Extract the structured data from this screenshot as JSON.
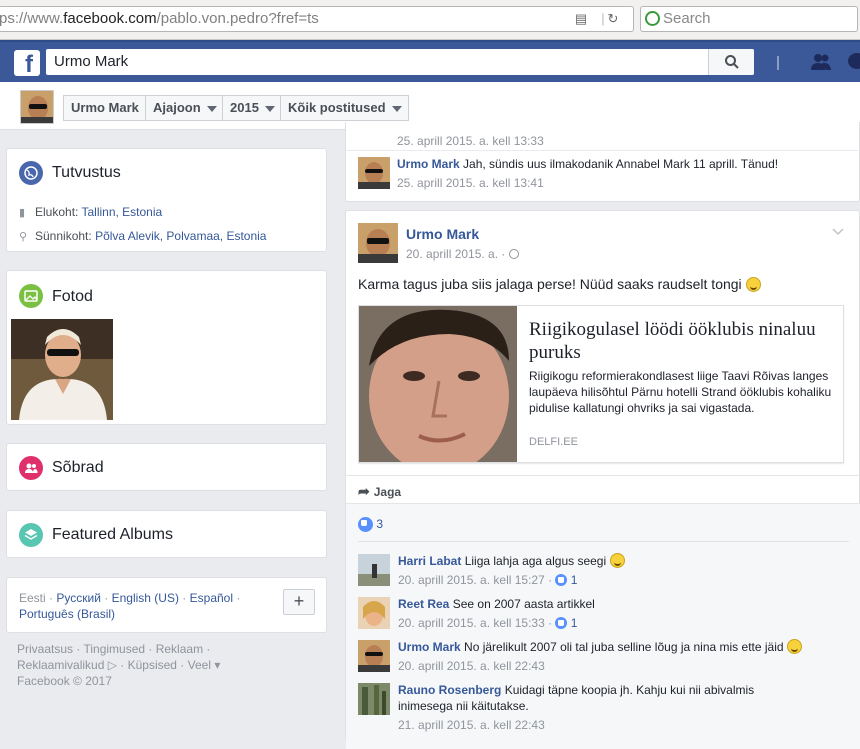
{
  "browser": {
    "url_prefix": "ps://www.",
    "url_domain": "facebook.com",
    "url_path": "/pablo.von.pedro?fref=ts",
    "search_placeholder": "Search"
  },
  "fb": {
    "logo": "f",
    "search_value": "Urmo Mark"
  },
  "timeline_nav": {
    "name": "Urmo Mark",
    "tab": "Ajajoon",
    "year": "2015",
    "filter": "Kõik postitused"
  },
  "intro": {
    "title": "Tutvustus",
    "residence_label": "Elukoht:",
    "residence_value": "Tallinn, Estonia",
    "birthplace_label": "Sünnikoht:",
    "birthplace_value": "Põlva Alevik, Polvamaa, Estonia"
  },
  "photos": {
    "title": "Fotod"
  },
  "friends": {
    "title": "Sõbrad"
  },
  "albums": {
    "title": "Featured Albums"
  },
  "languages": {
    "current": "Eesti",
    "sep": "·",
    "items": [
      "Русский",
      "English (US)",
      "Español",
      "Português (Brasil)"
    ],
    "add_label": "+"
  },
  "footer": {
    "line1": "Privaatsus · Tingimused · Reklaam ·",
    "line2a": "Reklaamivalikud",
    "line2b": "· Küpsised · Veel ▾",
    "line3": "Facebook © 2017"
  },
  "top_comment": {
    "prev_time": "25. aprill 2015. a. kell 13:33",
    "name": "Urmo Mark",
    "text": "Jah, sündis uus ilmakodanik Annabel Mark 11 aprill. Tänud!",
    "time": "25. aprill 2015. a. kell 13:41"
  },
  "post": {
    "author": "Urmo Mark",
    "date": "20. aprill 2015. a. ·",
    "text": "Karma tagus juba siis jalaga perse! Nüüd saaks raudselt tongi",
    "link_title": "Riigikogulasel löödi ööklubis ninaluu puruks",
    "link_desc": "Riigikogu reformierakondlasest liige Taavi Rõivas langes laupäeva hilisõhtul Pärnu hotelli Strand ööklubis kohaliku pidulise kallatungi ohvriks ja sai vigastada.",
    "link_source": "DELFI.EE",
    "share_label": "Jaga",
    "like_count": "3"
  },
  "comments": [
    {
      "name": "Harri Labat",
      "text": "Liiga lahja aga algus seegi",
      "time": "20. aprill 2015. a. kell 15:27 ·",
      "likes": "1"
    },
    {
      "name": "Reet Rea",
      "text": "See on 2007 aasta artikkel",
      "time": "20. aprill 2015. a. kell 15:33 ·",
      "likes": "1"
    },
    {
      "name": "Urmo Mark",
      "text": "No järelikult 2007 oli tal juba selline lõug ja nina mis ette jäid",
      "time": "20. aprill 2015. a. kell 22:43",
      "likes": ""
    },
    {
      "name": "Rauno Rosenberg",
      "text": "Kuidagi täpne koopia jh. Kahju kui nii abivalmis inimesega nii käitutakse.",
      "time": "21. aprill 2015. a. kell 22:43",
      "likes": ""
    }
  ],
  "colors": {
    "fb_blue": "#3b5998",
    "link": "#365899",
    "bg": "#e9ebee"
  }
}
